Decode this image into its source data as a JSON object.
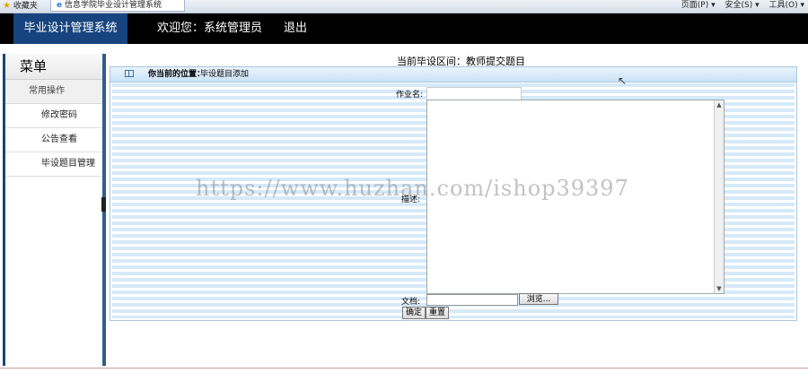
{
  "browser": {
    "favorites": "收藏夹",
    "tab_title": "信息学院毕业设计管理系统",
    "tools": [
      "页面(P) ▾",
      "安全(S) ▾",
      "工具(O) ▾"
    ]
  },
  "header": {
    "brand": "毕业设计管理系统",
    "welcome": "欢迎您：系统管理员",
    "logout": "退出"
  },
  "sidebar": {
    "title": "菜单",
    "group": "常用操作",
    "items": [
      "修改密码",
      "公告查看",
      "毕设题目管理"
    ]
  },
  "content": {
    "period": "当前毕设区间：教师提交题目",
    "crumb_label": "你当前的位置：",
    "crumb_value": "毕设题目添加"
  },
  "form": {
    "title_label": "作业名:",
    "title_value": "",
    "desc_label": "描述:",
    "file_label": "文档:",
    "browse_label": "浏览...",
    "confirm_label": "确定",
    "reset_label": "重置"
  },
  "watermark": "https://www.huzhan.com/ishop39397"
}
